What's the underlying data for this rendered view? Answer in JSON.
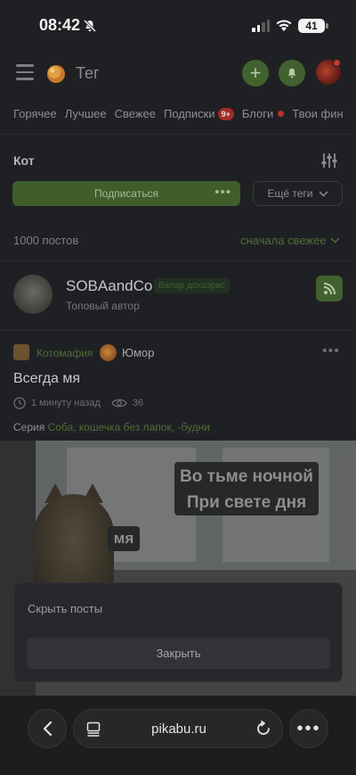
{
  "status": {
    "time": "08:42",
    "battery": "41"
  },
  "header": {
    "title": "Тег"
  },
  "nav": {
    "tabs": [
      {
        "label": "Горячее"
      },
      {
        "label": "Лучшее"
      },
      {
        "label": "Свежее"
      },
      {
        "label": "Подписки",
        "badge": "9+"
      },
      {
        "label": "Блоги"
      },
      {
        "label": "Твои фин"
      }
    ]
  },
  "tag": {
    "name": "Кот",
    "subscribe_label": "Подписаться",
    "subscribe_more": "•••",
    "more_tags_label": "Ещё теги",
    "post_count": "1000 постов",
    "sort_label": "сначала свежее"
  },
  "author": {
    "name": "SOBAandCo",
    "badge": "Валар дохаэрис",
    "role": "Топовый автор"
  },
  "post": {
    "community1": "Котомафия",
    "community2": "Юмор",
    "title": "Всегда мя",
    "time": "1 минуту назад",
    "views": "36",
    "series_label": "Серия",
    "series_link": "Соба, кошечка без лапок, -будни",
    "image_caption_line1": "Во тьме ночной",
    "image_caption_line2": "При свете дня",
    "image_caption_small": "мя"
  },
  "sheet": {
    "title": "Скрыть посты",
    "close_label": "Закрыть"
  },
  "browser": {
    "url": "pikabu.ru"
  },
  "colors": {
    "accent_green": "#41612f",
    "background": "#1f2023",
    "badge_red": "#a12b2a"
  }
}
